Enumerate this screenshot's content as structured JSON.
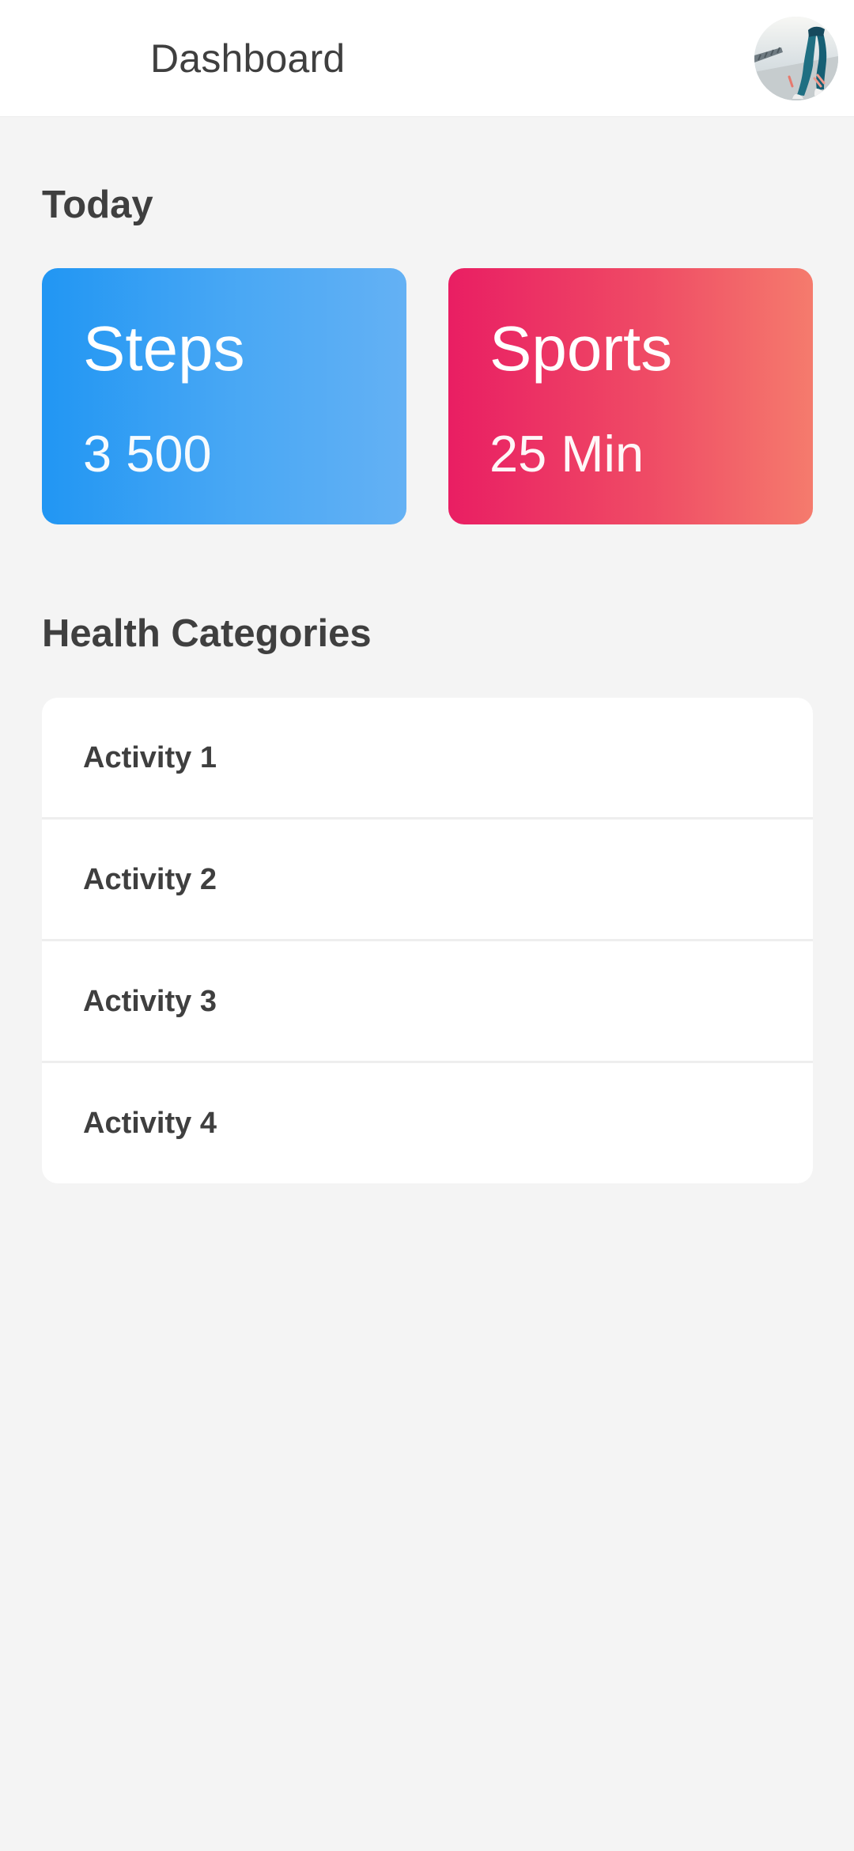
{
  "header": {
    "title": "Dashboard",
    "avatar_icon": "user-avatar-photo"
  },
  "today": {
    "section_title": "Today",
    "cards": [
      {
        "title": "Steps",
        "value": "3 500",
        "gradient": [
          "#2196f3",
          "#64b1f4"
        ]
      },
      {
        "title": "Sports",
        "value": "25 Min",
        "gradient": [
          "#e91e63",
          "#f57b6d"
        ]
      }
    ]
  },
  "health": {
    "section_title": "Health Categories",
    "items": [
      {
        "label": "Activity 1"
      },
      {
        "label": "Activity 2"
      },
      {
        "label": "Activity 3"
      },
      {
        "label": "Activity 4"
      }
    ]
  },
  "colors": {
    "background": "#f4f4f4",
    "surface": "#ffffff",
    "text": "#3f3f3f"
  }
}
